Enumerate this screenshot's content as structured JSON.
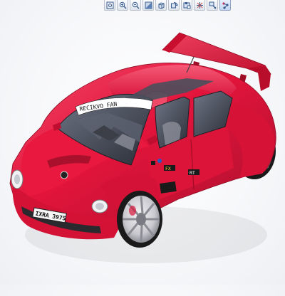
{
  "toolbar": {
    "buttons": [
      {
        "icon": "zoom-fit-icon"
      },
      {
        "icon": "zoom-in-icon"
      },
      {
        "icon": "zoom-out-icon"
      },
      {
        "icon": "shaded-view-icon"
      },
      {
        "icon": "orient-icon"
      },
      {
        "icon": "spin-icon"
      },
      {
        "icon": "saved-views-icon"
      },
      {
        "icon": "display-style-icon"
      },
      {
        "icon": "datum-display-icon"
      },
      {
        "icon": "spin-center-icon",
        "active": true
      }
    ]
  },
  "model": {
    "subject": "red-custom-beetle-race-car",
    "colors": {
      "body": "#e3143c",
      "body_shadow": "#a8102c",
      "body_highlight": "#f4506e",
      "glass": "#3b3f4a",
      "tire": "#1a1a1a",
      "rim": "#d8d8dc",
      "background": "#f7f8fa"
    },
    "license_plate": "IXRA 3975",
    "windshield_banner": "RECIKVO FAN",
    "side_decals": [
      "FX",
      "RT"
    ]
  }
}
